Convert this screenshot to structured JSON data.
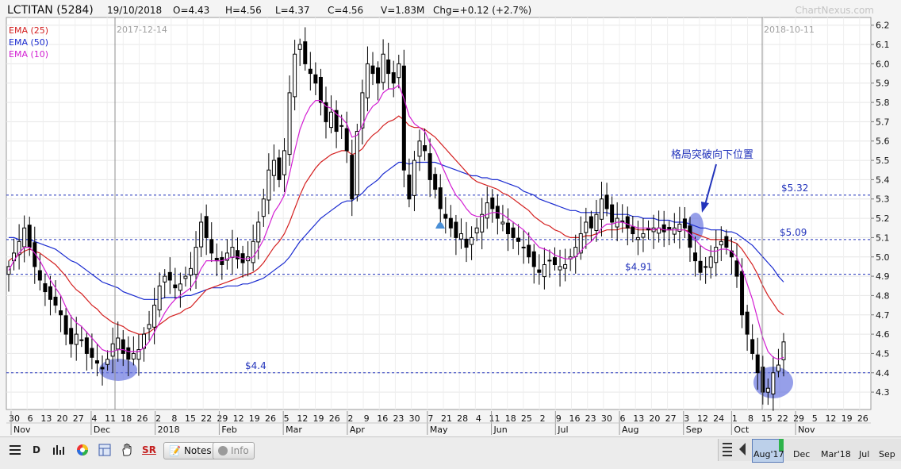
{
  "header": {
    "symbol": "LCTITAN (5284)",
    "date": "19/10/2018",
    "open": "O=4.43",
    "high": "H=4.56",
    "low": "L=4.37",
    "close": "C=4.56",
    "volume": "V=1.83M",
    "change": "Chg=+0.12 (+2.7%)",
    "brand": "ChartNexus.com"
  },
  "markers": {
    "left_date": "2017-12-14",
    "right_date": "2018-10-11",
    "annotation": "格局突破向下位置"
  },
  "colors": {
    "ema25": "#d42020",
    "ema50": "#1a2bd0",
    "ema10": "#d31fd3",
    "candle": "#000000",
    "hline": "#2233bb",
    "highlight": "#6a76e0"
  },
  "toolbar": {
    "notes_label": "Notes",
    "info_label": "Info",
    "d_label": "D",
    "sr_label": "SR",
    "range_labels": [
      "Aug'17",
      "Dec",
      "Mar'18",
      "Jul",
      "Sep"
    ],
    "icons": [
      "list-icon",
      "d-period-icon",
      "indicator-icon",
      "color-wheel-icon",
      "layout-icon",
      "hand-icon",
      "sr-icon",
      "notes-icon",
      "info-icon"
    ]
  },
  "chart_data": {
    "type": "candlestick",
    "title": "LCTITAN (5284)",
    "ylim": [
      4.21,
      6.24
    ],
    "y_ticks": [
      4.3,
      4.4,
      4.5,
      4.6,
      4.7,
      4.8,
      4.9,
      5.0,
      5.1,
      5.2,
      5.3,
      5.4,
      5.5,
      5.6,
      5.7,
      5.8,
      5.9,
      6.0,
      6.1,
      6.2
    ],
    "x_tick_labels": [
      "30",
      "6",
      "13",
      "20",
      "27",
      "4",
      "11",
      "18",
      "26",
      "2",
      "8",
      "15",
      "22",
      "29",
      "12",
      "19",
      "26",
      "5",
      "12",
      "19",
      "26",
      "2",
      "9",
      "16",
      "23",
      "30",
      "7",
      "21",
      "28",
      "4",
      "11",
      "18",
      "25",
      "2",
      "9",
      "16",
      "23",
      "30",
      "6",
      "13",
      "20",
      "27",
      "3",
      "12",
      "24",
      "1",
      "8",
      "15",
      "22",
      "29",
      "5",
      "12",
      "19",
      "26"
    ],
    "month_labels": [
      "Nov",
      "Dec",
      "2018",
      "Feb",
      "Mar",
      "Apr",
      "May",
      "Jun",
      "Jul",
      "Aug",
      "Sep",
      "Oct",
      "Nov"
    ],
    "legend": [
      {
        "name": "EMA (25)",
        "color": "#d42020"
      },
      {
        "name": "EMA (50)",
        "color": "#1a2bd0"
      },
      {
        "name": "EMA (10)",
        "color": "#d31fd3"
      }
    ],
    "levels": [
      {
        "label": "$5.32",
        "value": 5.32
      },
      {
        "label": "$5.09",
        "value": 5.09
      },
      {
        "label": "$4.91",
        "value": 4.91
      },
      {
        "label": "$4.4",
        "value": 4.4
      }
    ],
    "candles": {
      "period": "2017-10-30 to 2018-10-19 (sampled)",
      "close": [
        4.95,
        5.02,
        5.08,
        5.15,
        5.05,
        4.95,
        4.88,
        4.82,
        4.78,
        4.75,
        4.7,
        4.6,
        4.55,
        4.6,
        4.57,
        4.5,
        4.48,
        4.45,
        4.42,
        4.47,
        4.55,
        4.58,
        4.5,
        4.47,
        4.5,
        4.52,
        4.6,
        4.65,
        4.75,
        4.85,
        4.9,
        4.88,
        4.84,
        4.86,
        4.9,
        4.94,
        5.05,
        5.18,
        5.1,
        5.02,
        4.98,
        4.96,
        5.02,
        5.05,
        4.99,
        4.97,
        5.0,
        5.08,
        5.18,
        5.3,
        5.45,
        5.5,
        5.4,
        5.55,
        5.85,
        6.05,
        6.1,
        6.0,
        5.95,
        5.9,
        5.8,
        5.7,
        5.75,
        5.65,
        5.68,
        5.55,
        5.3,
        5.65,
        5.85,
        6.0,
        5.95,
        5.9,
        6.05,
        5.95,
        5.9,
        6.0,
        5.45,
        5.3,
        5.5,
        5.6,
        5.55,
        5.4,
        5.35,
        5.25,
        5.2,
        5.15,
        5.1,
        5.12,
        5.05,
        5.1,
        5.15,
        5.22,
        5.28,
        5.25,
        5.2,
        5.18,
        5.12,
        5.1,
        5.08,
        5.05,
        5.0,
        4.95,
        4.92,
        4.96,
        4.98,
        4.96,
        4.95,
        4.96,
        5.0,
        5.05,
        5.12,
        5.18,
        5.15,
        5.22,
        5.3,
        5.25,
        5.18,
        5.2,
        5.18,
        5.15,
        5.12,
        5.1,
        5.12,
        5.14,
        5.15,
        5.15,
        5.13,
        5.14,
        5.15,
        5.17,
        5.15,
        5.05,
        4.98,
        4.92,
        4.95,
        5.0,
        5.05,
        5.08,
        5.05,
        5.0,
        4.9,
        4.7,
        4.6,
        4.5,
        4.4,
        4.3,
        4.32,
        4.4,
        4.44,
        4.56
      ]
    },
    "ema10": [
      4.93,
      4.98,
      5.02,
      5.05,
      5.05,
      5.02,
      4.98,
      4.93,
      4.88,
      4.84,
      4.8,
      4.74,
      4.69,
      4.66,
      4.64,
      4.61,
      4.58,
      4.55,
      4.52,
      4.51,
      4.51,
      4.52,
      4.52,
      4.51,
      4.51,
      4.51,
      4.53,
      4.56,
      4.61,
      4.66,
      4.71,
      4.75,
      4.78,
      4.8,
      4.82,
      4.84,
      4.88,
      4.94,
      4.98,
      4.98,
      4.98,
      4.98,
      4.99,
      5.0,
      5.0,
      4.99,
      4.99,
      5.0,
      5.04,
      5.09,
      5.16,
      5.23,
      5.27,
      5.32,
      5.43,
      5.55,
      5.66,
      5.73,
      5.78,
      5.81,
      5.81,
      5.78,
      5.77,
      5.74,
      5.72,
      5.69,
      5.62,
      5.63,
      5.68,
      5.74,
      5.78,
      5.8,
      5.85,
      5.87,
      5.87,
      5.89,
      5.82,
      5.73,
      5.69,
      5.67,
      5.65,
      5.59,
      5.55,
      5.49,
      5.43,
      5.37,
      5.32,
      5.29,
      5.25,
      5.22,
      5.21,
      5.21,
      5.22,
      5.23,
      5.23,
      5.22,
      5.2,
      5.18,
      5.16,
      5.14,
      5.11,
      5.08,
      5.05,
      5.04,
      5.03,
      5.01,
      5.0,
      4.99,
      4.99,
      5.0,
      5.03,
      5.06,
      5.08,
      5.11,
      5.15,
      5.17,
      5.17,
      5.18,
      5.18,
      5.17,
      5.16,
      5.15,
      5.15,
      5.15,
      5.14,
      5.15,
      5.14,
      5.14,
      5.14,
      5.14,
      5.14,
      5.12,
      5.09,
      5.06,
      5.04,
      5.03,
      5.03,
      5.04,
      5.04,
      5.03,
      5.0,
      4.94,
      4.86,
      4.78,
      4.68,
      4.58,
      4.51,
      4.48,
      4.47,
      4.48
    ],
    "ema25": [
      4.98,
      5.0,
      5.01,
      5.03,
      5.04,
      5.03,
      5.02,
      5.0,
      4.98,
      4.96,
      4.93,
      4.9,
      4.86,
      4.83,
      4.81,
      4.78,
      4.75,
      4.73,
      4.7,
      4.68,
      4.66,
      4.65,
      4.64,
      4.62,
      4.61,
      4.6,
      4.6,
      4.61,
      4.63,
      4.65,
      4.67,
      4.69,
      4.7,
      4.71,
      4.73,
      4.74,
      4.77,
      4.8,
      4.83,
      4.84,
      4.85,
      4.86,
      4.87,
      4.88,
      4.89,
      4.9,
      4.91,
      4.92,
      4.94,
      4.97,
      5.01,
      5.05,
      5.08,
      5.12,
      5.18,
      5.25,
      5.32,
      5.38,
      5.42,
      5.46,
      5.49,
      5.51,
      5.53,
      5.54,
      5.55,
      5.55,
      5.53,
      5.54,
      5.56,
      5.6,
      5.63,
      5.65,
      5.68,
      5.7,
      5.71,
      5.73,
      5.71,
      5.68,
      5.67,
      5.67,
      5.66,
      5.64,
      5.62,
      5.59,
      5.56,
      5.53,
      5.5,
      5.47,
      5.44,
      5.41,
      5.39,
      5.38,
      5.37,
      5.36,
      5.35,
      5.33,
      5.32,
      5.3,
      5.28,
      5.26,
      5.24,
      5.21,
      5.19,
      5.17,
      5.16,
      5.14,
      5.13,
      5.11,
      5.1,
      5.1,
      5.1,
      5.11,
      5.11,
      5.12,
      5.13,
      5.14,
      5.14,
      5.14,
      5.15,
      5.15,
      5.15,
      5.14,
      5.14,
      5.14,
      5.14,
      5.14,
      5.14,
      5.14,
      5.14,
      5.14,
      5.14,
      5.13,
      5.12,
      5.11,
      5.1,
      5.09,
      5.09,
      5.09,
      5.09,
      5.08,
      5.07,
      5.04,
      5.0,
      4.96,
      4.91,
      4.85,
      4.8,
      4.76,
      4.72,
      4.7
    ],
    "ema50": [
      5.1,
      5.1,
      5.09,
      5.09,
      5.09,
      5.08,
      5.07,
      5.06,
      5.05,
      5.04,
      5.02,
      5.0,
      4.98,
      4.97,
      4.95,
      4.93,
      4.91,
      4.89,
      4.87,
      4.86,
      4.85,
      4.84,
      4.82,
      4.81,
      4.8,
      4.79,
      4.78,
      4.78,
      4.78,
      4.78,
      4.79,
      4.79,
      4.79,
      4.79,
      4.8,
      4.8,
      4.81,
      4.82,
      4.83,
      4.84,
      4.84,
      4.84,
      4.85,
      4.85,
      4.85,
      4.86,
      4.86,
      4.87,
      4.88,
      4.89,
      4.91,
      4.93,
      4.95,
      4.97,
      5.0,
      5.04,
      5.08,
      5.11,
      5.14,
      5.17,
      5.2,
      5.22,
      5.24,
      5.26,
      5.28,
      5.29,
      5.29,
      5.31,
      5.33,
      5.36,
      5.38,
      5.4,
      5.43,
      5.45,
      5.47,
      5.49,
      5.49,
      5.48,
      5.49,
      5.49,
      5.49,
      5.49,
      5.49,
      5.48,
      5.47,
      5.46,
      5.45,
      5.44,
      5.43,
      5.42,
      5.42,
      5.41,
      5.41,
      5.4,
      5.4,
      5.39,
      5.38,
      5.37,
      5.36,
      5.34,
      5.33,
      5.32,
      5.3,
      5.29,
      5.28,
      5.27,
      5.26,
      5.25,
      5.24,
      5.24,
      5.23,
      5.23,
      5.23,
      5.23,
      5.23,
      5.23,
      5.22,
      5.22,
      5.22,
      5.22,
      5.21,
      5.21,
      5.2,
      5.2,
      5.2,
      5.19,
      5.19,
      5.19,
      5.18,
      5.18,
      5.18,
      5.17,
      5.16,
      5.15,
      5.15,
      5.14,
      5.14,
      5.14,
      5.13,
      5.13,
      5.12,
      5.1,
      5.08,
      5.06,
      5.03,
      5.0,
      4.97,
      4.94,
      4.9,
      4.87
    ]
  }
}
